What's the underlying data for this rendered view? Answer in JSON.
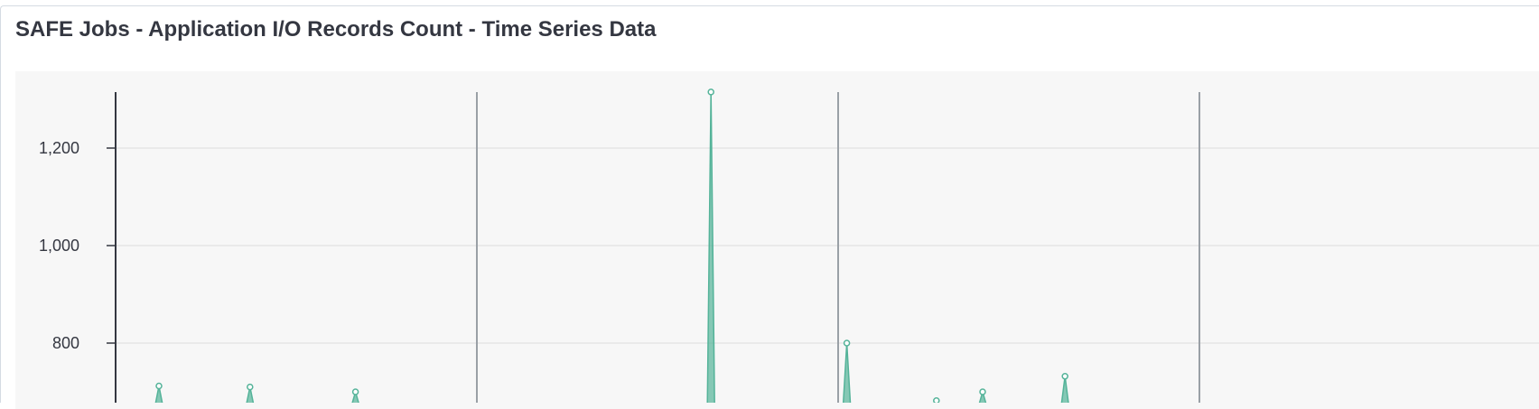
{
  "panel": {
    "title": "SAFE Jobs - Application I/O Records Count - Time Series Data"
  },
  "colors": {
    "series": "#54b399",
    "plot_background": "#f7f7f7",
    "gridline": "#e6e6e6",
    "axis": "#343741",
    "marker_line": "#9aa0a6",
    "title": "#343741"
  },
  "chart_data": {
    "type": "area",
    "title": "SAFE Jobs - Application I/O Records Count - Time Series Data",
    "xlabel": "",
    "ylabel": "",
    "ylim": [
      600,
      1320
    ],
    "xlim": [
      0,
      100
    ],
    "yticks": [
      {
        "value": 1200,
        "label": "1,200"
      },
      {
        "value": 1000,
        "label": "1,000"
      },
      {
        "value": 800,
        "label": "800"
      }
    ],
    "vertical_markers": [
      25,
      50,
      75
    ],
    "grid": true,
    "series": [
      {
        "points": [
          {
            "x": 3.0,
            "y": 712
          },
          {
            "x": 9.3,
            "y": 710
          },
          {
            "x": 16.6,
            "y": 700
          },
          {
            "x": 41.2,
            "y": 1315
          },
          {
            "x": 50.6,
            "y": 800
          },
          {
            "x": 56.8,
            "y": 682
          },
          {
            "x": 60.0,
            "y": 700
          },
          {
            "x": 65.7,
            "y": 732
          }
        ]
      }
    ]
  }
}
